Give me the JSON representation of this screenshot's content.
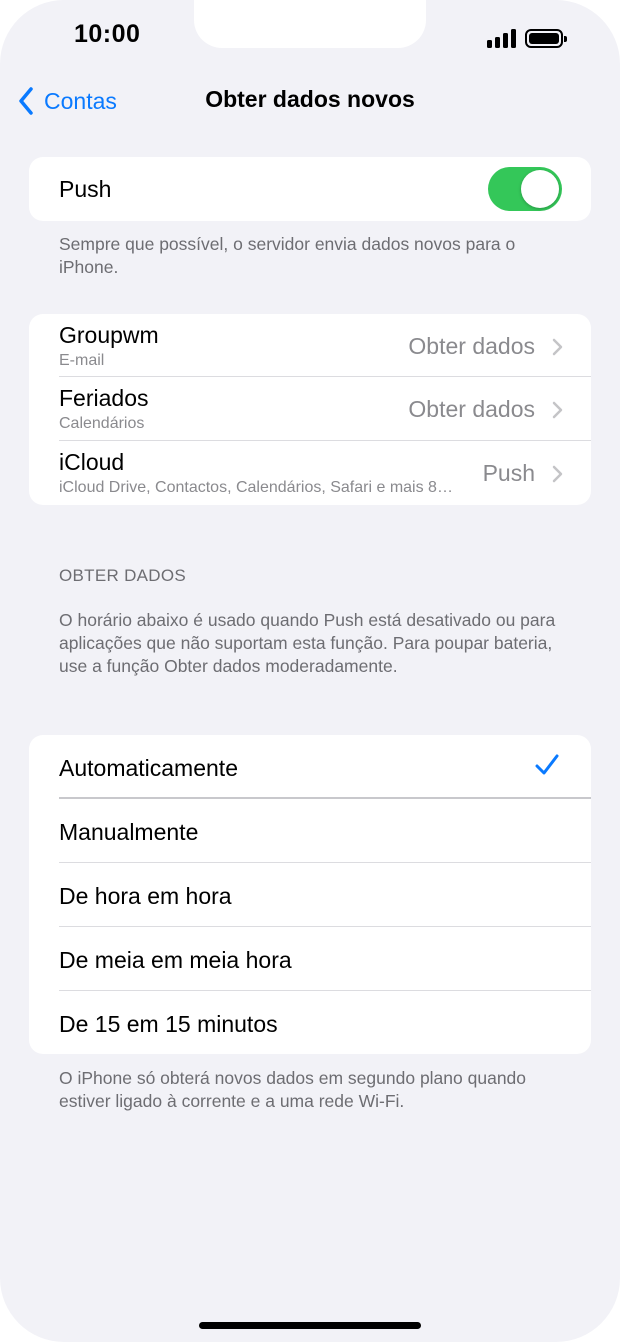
{
  "status_bar": {
    "time": "10:00"
  },
  "nav": {
    "back_label": "Contas",
    "title": "Obter dados novos"
  },
  "push": {
    "label": "Push",
    "enabled": true,
    "footer": "Sempre que possível, o servidor envia dados novos para o iPhone."
  },
  "accounts": [
    {
      "name": "Groupwm",
      "subtitle": "E-mail",
      "value": "Obter dados"
    },
    {
      "name": "Feriados",
      "subtitle": "Calendários",
      "value": "Obter dados"
    },
    {
      "name": "iCloud",
      "subtitle": "iCloud Drive, Contactos, Calendários, Safari e mais 8…",
      "value": "Push"
    }
  ],
  "fetch": {
    "header": "OBTER DADOS",
    "description": "O horário abaixo é usado quando Push está desativado ou para aplicações que não suportam esta função. Para poupar bateria, use a função Obter dados moderadamente.",
    "options": [
      {
        "label": "Automaticamente",
        "selected": true
      },
      {
        "label": "Manualmente",
        "selected": false
      },
      {
        "label": "De hora em hora",
        "selected": false
      },
      {
        "label": "De meia em meia hora",
        "selected": false
      },
      {
        "label": "De 15 em 15 minutos",
        "selected": false
      }
    ],
    "footer": "O iPhone só obterá novos dados em segundo plano quando estiver ligado à corrente e a uma rede Wi-Fi."
  },
  "colors": {
    "accent": "#0a7aff",
    "toggle_on": "#34c759",
    "background": "#f2f2f7",
    "secondary_text": "#6d6d72"
  },
  "icons": [
    "chevron-left-icon",
    "chevron-right-icon",
    "checkmark-icon",
    "signal-icon",
    "battery-icon"
  ]
}
